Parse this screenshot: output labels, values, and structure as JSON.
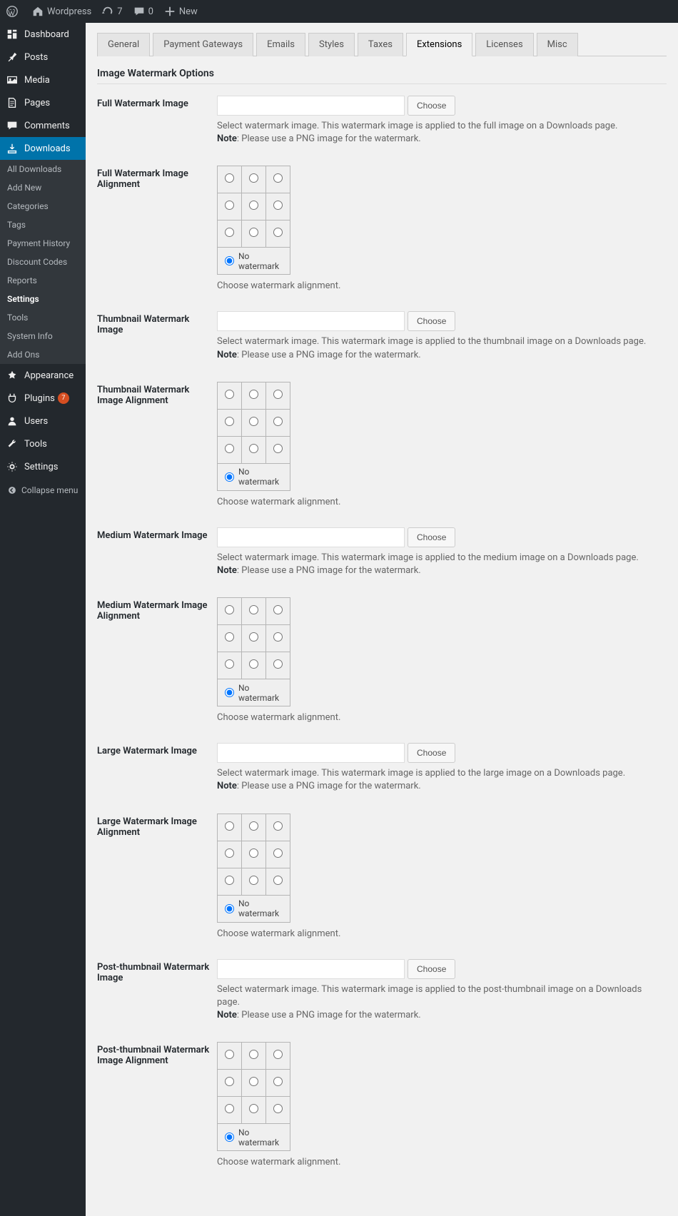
{
  "toolbar": {
    "site_name": "Wordpress",
    "updates_count": "7",
    "comments_count": "0",
    "new_label": "New"
  },
  "sidebar": {
    "main_items": [
      {
        "icon": "dashboard",
        "label": "Dashboard"
      },
      {
        "icon": "pin",
        "label": "Posts"
      },
      {
        "icon": "media",
        "label": "Media"
      },
      {
        "icon": "pages",
        "label": "Pages"
      },
      {
        "icon": "comments",
        "label": "Comments"
      },
      {
        "icon": "downloads",
        "label": "Downloads",
        "active": true
      }
    ],
    "sub_items": [
      {
        "label": "All Downloads"
      },
      {
        "label": "Add New"
      },
      {
        "label": "Categories"
      },
      {
        "label": "Tags"
      },
      {
        "label": "Payment History"
      },
      {
        "label": "Discount Codes"
      },
      {
        "label": "Reports"
      },
      {
        "label": "Settings",
        "current": true
      },
      {
        "label": "Tools"
      },
      {
        "label": "System Info"
      },
      {
        "label": "Add Ons"
      }
    ],
    "lower_items": [
      {
        "icon": "appearance",
        "label": "Appearance"
      },
      {
        "icon": "plugins",
        "label": "Plugins",
        "badge": "7"
      },
      {
        "icon": "users",
        "label": "Users"
      },
      {
        "icon": "tools",
        "label": "Tools"
      },
      {
        "icon": "settings",
        "label": "Settings"
      }
    ],
    "collapse_label": "Collapse menu"
  },
  "tabs": [
    {
      "label": "General"
    },
    {
      "label": "Payment Gateways"
    },
    {
      "label": "Emails"
    },
    {
      "label": "Styles"
    },
    {
      "label": "Taxes"
    },
    {
      "label": "Extensions",
      "active": true
    },
    {
      "label": "Licenses"
    },
    {
      "label": "Misc"
    }
  ],
  "section_title": "Image Watermark Options",
  "choose_label": "Choose",
  "no_watermark_label": "No watermark",
  "align_caption": "Choose watermark alignment.",
  "note_label": "Note",
  "note_text": ": Please use a PNG image for the watermark.",
  "sections": [
    {
      "key": "full",
      "image_label": "Full Watermark Image",
      "align_label": "Full Watermark Image Alignment",
      "helper": "Select watermark image. This watermark image is applied to the full image on a Downloads page."
    },
    {
      "key": "thumbnail",
      "image_label": "Thumbnail Watermark Image",
      "align_label": "Thumbnail Watermark Image Alignment",
      "helper": "Select watermark image. This watermark image is applied to the thumbnail image on a Downloads page."
    },
    {
      "key": "medium",
      "image_label": "Medium Watermark Image",
      "align_label": "Medium Watermark Image Alignment",
      "helper": "Select watermark image. This watermark image is applied to the medium image on a Downloads page."
    },
    {
      "key": "large",
      "image_label": "Large Watermark Image",
      "align_label": "Large Watermark Image Alignment",
      "helper": "Select watermark image. This watermark image is applied to the large image on a Downloads page."
    },
    {
      "key": "post-thumbnail",
      "image_label": "Post-thumbnail Watermark Image",
      "align_label": "Post-thumbnail Watermark Image Alignment",
      "helper": "Select watermark image. This watermark image is applied to the post-thumbnail image on a Downloads page."
    }
  ]
}
